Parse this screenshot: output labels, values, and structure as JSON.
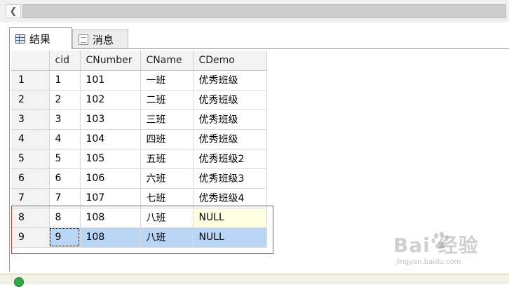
{
  "tabs": [
    {
      "label": "结果",
      "icon": "grid-icon",
      "active": true
    },
    {
      "label": "消息",
      "icon": "message-icon",
      "active": false
    }
  ],
  "grid": {
    "columns": [
      "cid",
      "CNumber",
      "CName",
      "CDemo"
    ],
    "rows": [
      {
        "num": "1",
        "cid": "1",
        "cnumber": "101",
        "cname": "一班",
        "cdemo": "优秀班级"
      },
      {
        "num": "2",
        "cid": "2",
        "cnumber": "102",
        "cname": "二班",
        "cdemo": "优秀班级"
      },
      {
        "num": "3",
        "cid": "3",
        "cnumber": "103",
        "cname": "三班",
        "cdemo": "优秀班级"
      },
      {
        "num": "4",
        "cid": "4",
        "cnumber": "104",
        "cname": "四班",
        "cdemo": "优秀班级"
      },
      {
        "num": "5",
        "cid": "5",
        "cnumber": "105",
        "cname": "五班",
        "cdemo": "优秀班级2"
      },
      {
        "num": "6",
        "cid": "6",
        "cnumber": "106",
        "cname": "六班",
        "cdemo": "优秀班级3"
      },
      {
        "num": "7",
        "cid": "7",
        "cnumber": "107",
        "cname": "七班",
        "cdemo": "优秀班级4"
      },
      {
        "num": "8",
        "cid": "8",
        "cnumber": "108",
        "cname": "八班",
        "cdemo": "NULL"
      },
      {
        "num": "9",
        "cid": "9",
        "cnumber": "108",
        "cname": "八班",
        "cdemo": "NULL"
      }
    ]
  },
  "colors": {
    "selected_row": "#b9d6f7",
    "null_cell": "#ffffe1",
    "annotation_box": "#d43c3c"
  },
  "watermark": {
    "text": "Bai  经验",
    "url": "jingyan.baidu.com"
  }
}
